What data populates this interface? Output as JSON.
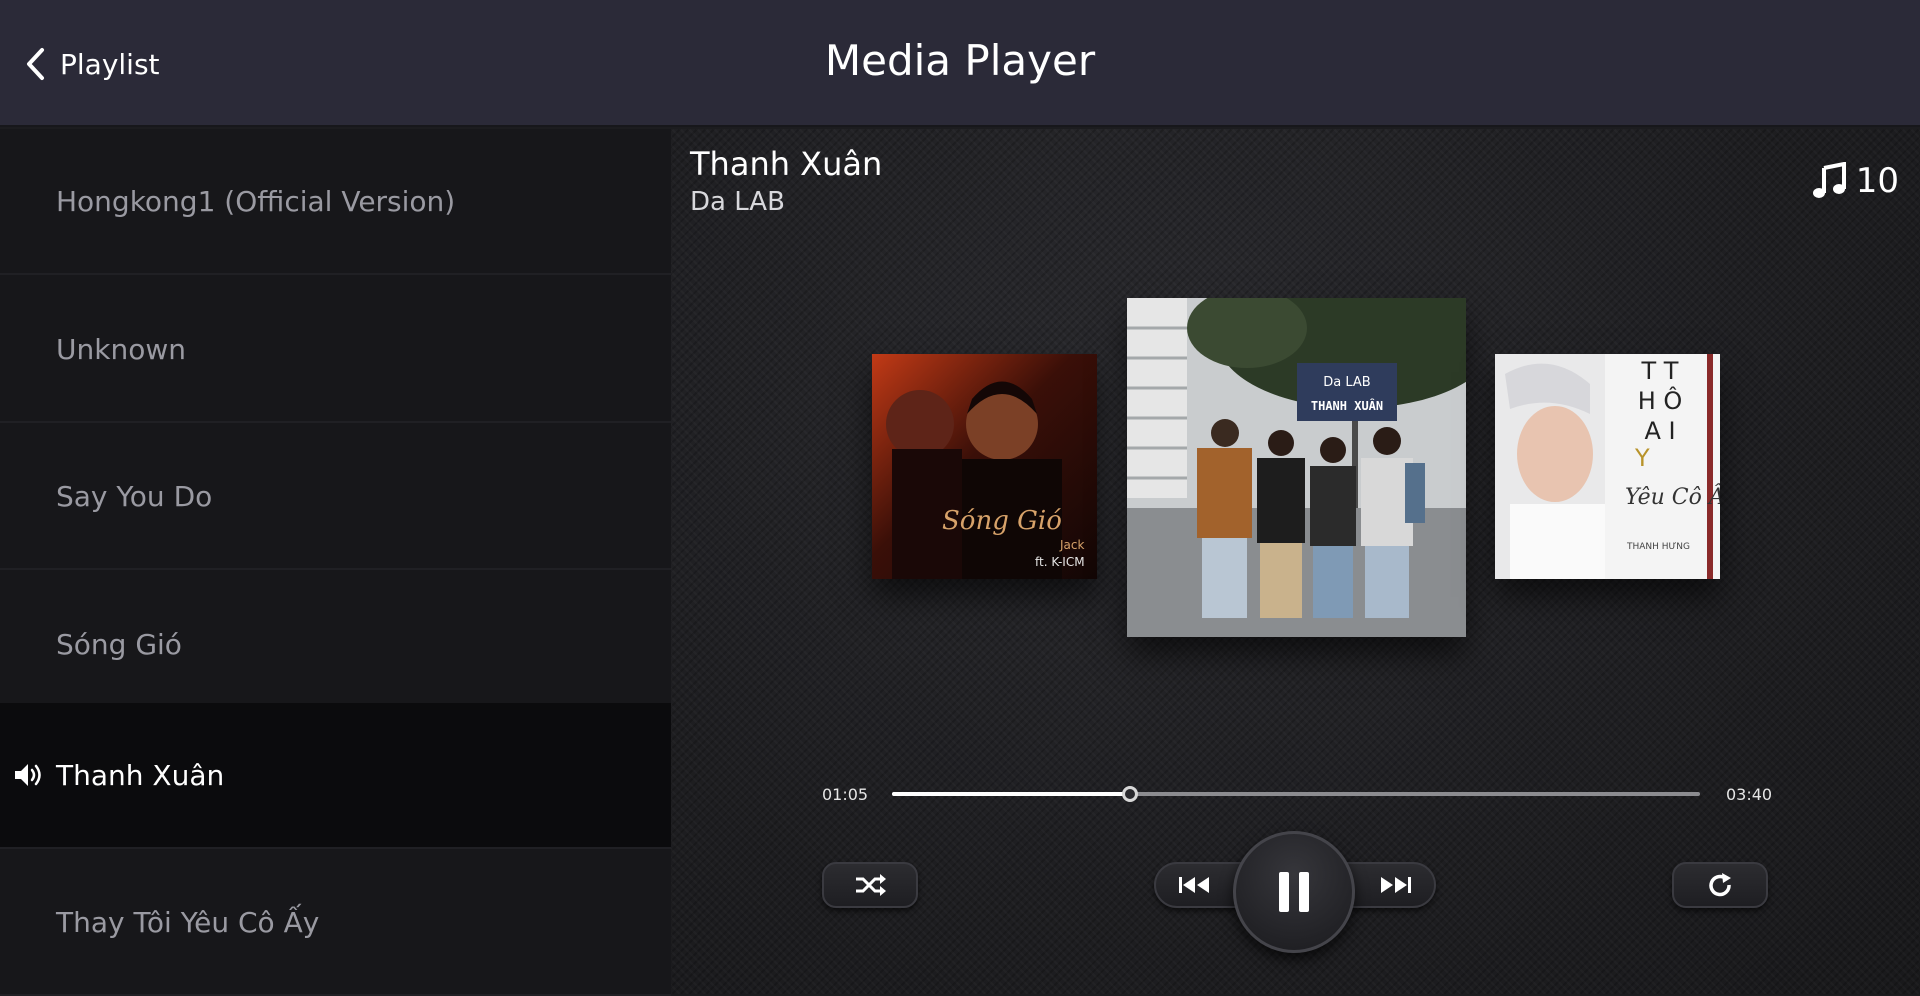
{
  "header": {
    "back_label": "Playlist",
    "title": "Media Player"
  },
  "playlist": {
    "items": [
      {
        "label": "Hongkong1 (Official Version)",
        "active": false
      },
      {
        "label": "Unknown",
        "active": false
      },
      {
        "label": "Say You Do",
        "active": false
      },
      {
        "label": "Sóng Gió",
        "active": false
      },
      {
        "label": "Thanh Xuân",
        "active": true
      },
      {
        "label": "Thay Tôi Yêu Cô Ấy",
        "active": false
      }
    ]
  },
  "now_playing": {
    "title": "Thanh Xuân",
    "artist": "Da LAB",
    "track_count": "10",
    "current_time": "01:05",
    "total_time": "03:40",
    "progress_fraction": 0.295
  },
  "covers": {
    "left": {
      "script": "Sóng Gió",
      "credit": "Jack",
      "feat": "ft. K-ICM"
    },
    "center": {
      "sign_top": "Da LAB",
      "sign_bottom": "THANH XUÂN"
    },
    "right": {
      "title_lines": [
        "T T",
        "H Ô",
        "A I",
        "Y"
      ],
      "script": "Yêu Cô Ấy",
      "artist": "THANH HƯNG"
    }
  },
  "controls": {
    "shuffle_icon": "shuffle-icon",
    "prev_icon": "previous-icon",
    "play_state": "pause-icon",
    "next_icon": "next-icon",
    "repeat_icon": "repeat-icon"
  },
  "colors": {
    "header_bg": "#2b2a38",
    "sidebar_bg": "#17171a",
    "active_row_bg": "#0b0b0d",
    "inactive_text": "#9a9aa2"
  }
}
